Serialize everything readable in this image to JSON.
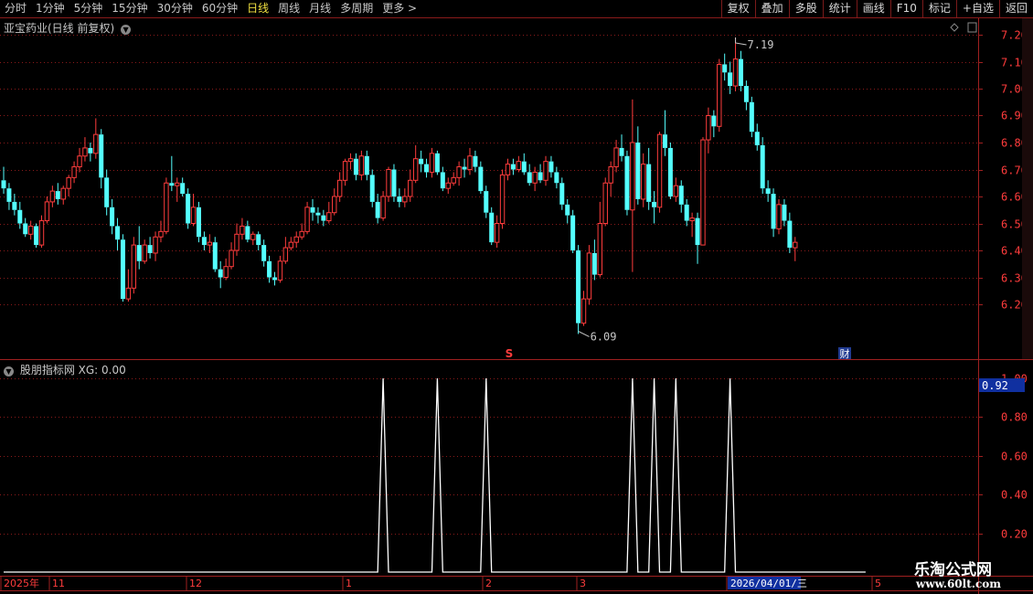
{
  "toolbar": {
    "periods": [
      "分时",
      "1分钟",
      "5分钟",
      "15分钟",
      "30分钟",
      "60分钟",
      "日线",
      "周线",
      "月线",
      "多周期",
      "更多 >"
    ],
    "active": "日线",
    "right": [
      "复权",
      "叠加",
      "多股",
      "统计",
      "画线",
      "F10",
      "标记",
      "+自选",
      "返回"
    ]
  },
  "main": {
    "title": "亚宝药业(日线 前复权)",
    "y_ticks": [
      "7.20",
      "7.10",
      "7.00",
      "6.90",
      "6.80",
      "6.70",
      "6.60",
      "6.50",
      "6.40",
      "6.30",
      "6.20"
    ],
    "high_label": "7.19",
    "low_label": "6.09",
    "marker_s": "S",
    "marker_cai": "财"
  },
  "indicator": {
    "title": "股朋指标网 XG: 0.00",
    "y_ticks": [
      "1.00",
      "0.80",
      "0.60",
      "0.40",
      "0.20"
    ],
    "cursor_value": "0.92"
  },
  "timeline": {
    "labels": [
      "2025年",
      "11",
      "12",
      "1",
      "2",
      "3",
      "2026/04/01/三",
      "5"
    ]
  },
  "watermark": {
    "line1": "乐淘公式网",
    "line2": "www.60lt.com"
  },
  "chart_data": [
    {
      "type": "candlestick",
      "title": "亚宝药业(日线 前复权)",
      "ylim": [
        6.09,
        7.22
      ],
      "y_ticks": [
        6.2,
        6.3,
        6.4,
        6.5,
        6.6,
        6.7,
        6.8,
        6.9,
        7.0,
        7.1,
        7.2
      ],
      "grid": true,
      "candles": [
        [
          6.66,
          6.63,
          6.71,
          6.61
        ],
        [
          6.63,
          6.58,
          6.65,
          6.55
        ],
        [
          6.58,
          6.55,
          6.61,
          6.53
        ],
        [
          6.55,
          6.5,
          6.58,
          6.48
        ],
        [
          6.5,
          6.46,
          6.52,
          6.45
        ],
        [
          6.46,
          6.49,
          6.51,
          6.44
        ],
        [
          6.49,
          6.42,
          6.5,
          6.41
        ],
        [
          6.42,
          6.51,
          6.53,
          6.41
        ],
        [
          6.51,
          6.58,
          6.6,
          6.5
        ],
        [
          6.58,
          6.62,
          6.64,
          6.56
        ],
        [
          6.62,
          6.59,
          6.65,
          6.57
        ],
        [
          6.59,
          6.63,
          6.64,
          6.57
        ],
        [
          6.63,
          6.67,
          6.68,
          6.6
        ],
        [
          6.67,
          6.71,
          6.73,
          6.65
        ],
        [
          6.71,
          6.75,
          6.78,
          6.69
        ],
        [
          6.75,
          6.78,
          6.82,
          6.73
        ],
        [
          6.78,
          6.76,
          6.8,
          6.73
        ],
        [
          6.76,
          6.83,
          6.89,
          6.74
        ],
        [
          6.83,
          6.67,
          6.85,
          6.63
        ],
        [
          6.67,
          6.56,
          6.7,
          6.53
        ],
        [
          6.56,
          6.49,
          6.59,
          6.46
        ],
        [
          6.49,
          6.44,
          6.52,
          6.4
        ],
        [
          6.44,
          6.22,
          6.46,
          6.21
        ],
        [
          6.22,
          6.26,
          6.33,
          6.21
        ],
        [
          6.26,
          6.42,
          6.45,
          6.24
        ],
        [
          6.42,
          6.36,
          6.49,
          6.33
        ],
        [
          6.36,
          6.42,
          6.44,
          6.35
        ],
        [
          6.42,
          6.39,
          6.45,
          6.37
        ],
        [
          6.39,
          6.45,
          6.47,
          6.36
        ],
        [
          6.45,
          6.47,
          6.51,
          6.43
        ],
        [
          6.47,
          6.65,
          6.67,
          6.46
        ],
        [
          6.65,
          6.64,
          6.75,
          6.62
        ],
        [
          6.64,
          6.65,
          6.67,
          6.58
        ],
        [
          6.65,
          6.61,
          6.67,
          6.6
        ],
        [
          6.61,
          6.5,
          6.63,
          6.48
        ],
        [
          6.5,
          6.56,
          6.61,
          6.49
        ],
        [
          6.56,
          6.45,
          6.58,
          6.43
        ],
        [
          6.45,
          6.42,
          6.47,
          6.4
        ],
        [
          6.42,
          6.43,
          6.46,
          6.39
        ],
        [
          6.43,
          6.33,
          6.45,
          6.32
        ],
        [
          6.33,
          6.3,
          6.36,
          6.26
        ],
        [
          6.3,
          6.34,
          6.37,
          6.29
        ],
        [
          6.34,
          6.4,
          6.43,
          6.33
        ],
        [
          6.4,
          6.46,
          6.5,
          6.38
        ],
        [
          6.46,
          6.49,
          6.52,
          6.44
        ],
        [
          6.49,
          6.44,
          6.51,
          6.43
        ],
        [
          6.44,
          6.46,
          6.47,
          6.42
        ],
        [
          6.46,
          6.42,
          6.47,
          6.4
        ],
        [
          6.42,
          6.36,
          6.44,
          6.34
        ],
        [
          6.36,
          6.3,
          6.38,
          6.28
        ],
        [
          6.3,
          6.29,
          6.32,
          6.27
        ],
        [
          6.29,
          6.36,
          6.38,
          6.28
        ],
        [
          6.36,
          6.41,
          6.45,
          6.35
        ],
        [
          6.41,
          6.43,
          6.45,
          6.4
        ],
        [
          6.43,
          6.45,
          6.47,
          6.41
        ],
        [
          6.45,
          6.47,
          6.5,
          6.44
        ],
        [
          6.47,
          6.56,
          6.58,
          6.46
        ],
        [
          6.56,
          6.54,
          6.59,
          6.51
        ],
        [
          6.54,
          6.53,
          6.56,
          6.5
        ],
        [
          6.53,
          6.51,
          6.55,
          6.49
        ],
        [
          6.51,
          6.54,
          6.58,
          6.5
        ],
        [
          6.54,
          6.6,
          6.63,
          6.53
        ],
        [
          6.6,
          6.66,
          6.69,
          6.58
        ],
        [
          6.66,
          6.73,
          6.74,
          6.64
        ],
        [
          6.73,
          6.74,
          6.76,
          6.7
        ],
        [
          6.74,
          6.68,
          6.76,
          6.66
        ],
        [
          6.68,
          6.75,
          6.77,
          6.66
        ],
        [
          6.75,
          6.68,
          6.77,
          6.66
        ],
        [
          6.68,
          6.58,
          6.7,
          6.56
        ],
        [
          6.58,
          6.52,
          6.61,
          6.5
        ],
        [
          6.52,
          6.6,
          6.62,
          6.51
        ],
        [
          6.6,
          6.7,
          6.71,
          6.58
        ],
        [
          6.7,
          6.6,
          6.72,
          6.58
        ],
        [
          6.6,
          6.58,
          6.63,
          6.56
        ],
        [
          6.58,
          6.6,
          6.63,
          6.56
        ],
        [
          6.6,
          6.66,
          6.7,
          6.58
        ],
        [
          6.66,
          6.74,
          6.79,
          6.65
        ],
        [
          6.74,
          6.72,
          6.77,
          6.69
        ],
        [
          6.72,
          6.69,
          6.74,
          6.67
        ],
        [
          6.69,
          6.76,
          6.78,
          6.67
        ],
        [
          6.76,
          6.69,
          6.77,
          6.68
        ],
        [
          6.69,
          6.63,
          6.71,
          6.62
        ],
        [
          6.63,
          6.65,
          6.67,
          6.61
        ],
        [
          6.65,
          6.67,
          6.69,
          6.64
        ],
        [
          6.67,
          6.71,
          6.73,
          6.64
        ],
        [
          6.71,
          6.7,
          6.74,
          6.67
        ],
        [
          6.7,
          6.75,
          6.78,
          6.68
        ],
        [
          6.75,
          6.71,
          6.77,
          6.69
        ],
        [
          6.71,
          6.62,
          6.73,
          6.61
        ],
        [
          6.62,
          6.54,
          6.64,
          6.52
        ],
        [
          6.54,
          6.43,
          6.56,
          6.42
        ],
        [
          6.43,
          6.5,
          6.53,
          6.41
        ],
        [
          6.5,
          6.68,
          6.7,
          6.48
        ],
        [
          6.68,
          6.72,
          6.74,
          6.66
        ],
        [
          6.72,
          6.7,
          6.74,
          6.68
        ],
        [
          6.7,
          6.73,
          6.75,
          6.69
        ],
        [
          6.73,
          6.69,
          6.76,
          6.68
        ],
        [
          6.69,
          6.65,
          6.72,
          6.64
        ],
        [
          6.65,
          6.69,
          6.71,
          6.62
        ],
        [
          6.69,
          6.66,
          6.72,
          6.65
        ],
        [
          6.66,
          6.73,
          6.75,
          6.64
        ],
        [
          6.73,
          6.69,
          6.75,
          6.67
        ],
        [
          6.69,
          6.65,
          6.71,
          6.63
        ],
        [
          6.65,
          6.57,
          6.67,
          6.55
        ],
        [
          6.57,
          6.53,
          6.59,
          6.5
        ],
        [
          6.53,
          6.4,
          6.55,
          6.39
        ],
        [
          6.4,
          6.13,
          6.42,
          6.09
        ],
        [
          6.13,
          6.22,
          6.25,
          6.12
        ],
        [
          6.22,
          6.39,
          6.42,
          6.2
        ],
        [
          6.39,
          6.31,
          6.44,
          6.29
        ],
        [
          6.31,
          6.5,
          6.58,
          6.3
        ],
        [
          6.5,
          6.65,
          6.67,
          6.49
        ],
        [
          6.65,
          6.71,
          6.73,
          6.6
        ],
        [
          6.71,
          6.78,
          6.81,
          6.69
        ],
        [
          6.78,
          6.75,
          6.83,
          6.73
        ],
        [
          6.75,
          6.55,
          6.77,
          6.53
        ],
        [
          6.55,
          6.8,
          6.96,
          6.32
        ],
        [
          6.8,
          6.59,
          6.86,
          6.57
        ],
        [
          6.59,
          6.72,
          6.76,
          6.56
        ],
        [
          6.72,
          6.58,
          6.78,
          6.55
        ],
        [
          6.58,
          6.56,
          6.62,
          6.5
        ],
        [
          6.56,
          6.83,
          6.84,
          6.54
        ],
        [
          6.83,
          6.78,
          6.92,
          6.75
        ],
        [
          6.78,
          6.6,
          6.8,
          6.59
        ],
        [
          6.6,
          6.64,
          6.67,
          6.58
        ],
        [
          6.64,
          6.57,
          6.66,
          6.54
        ],
        [
          6.57,
          6.51,
          6.59,
          6.49
        ],
        [
          6.51,
          6.52,
          6.54,
          6.45
        ],
        [
          6.52,
          6.42,
          6.54,
          6.35
        ],
        [
          6.42,
          6.81,
          6.82,
          6.42
        ],
        [
          6.81,
          6.9,
          6.93,
          6.76
        ],
        [
          6.9,
          6.86,
          6.92,
          6.82
        ],
        [
          6.86,
          7.09,
          7.11,
          6.84
        ],
        [
          7.09,
          7.06,
          7.13,
          7.03
        ],
        [
          7.06,
          7.01,
          7.1,
          6.98
        ],
        [
          7.01,
          7.11,
          7.19,
          6.99
        ],
        [
          7.11,
          7.01,
          7.14,
          6.99
        ],
        [
          7.01,
          6.95,
          7.03,
          6.92
        ],
        [
          6.95,
          6.84,
          6.97,
          6.82
        ],
        [
          6.84,
          6.79,
          6.87,
          6.77
        ],
        [
          6.79,
          6.63,
          6.82,
          6.61
        ],
        [
          6.63,
          6.61,
          6.66,
          6.58
        ],
        [
          6.61,
          6.48,
          6.63,
          6.45
        ],
        [
          6.48,
          6.57,
          6.59,
          6.46
        ],
        [
          6.57,
          6.51,
          6.59,
          6.49
        ],
        [
          6.51,
          6.41,
          6.54,
          6.39
        ],
        [
          6.41,
          6.43,
          6.45,
          6.36
        ]
      ]
    },
    {
      "type": "line",
      "title": "股朋指标网 XG",
      "ylim": [
        0,
        1
      ],
      "y_ticks": [
        0.2,
        0.4,
        0.6,
        0.8,
        1.0
      ],
      "series": [
        {
          "values": [
            0,
            0,
            0,
            0,
            0,
            0,
            0,
            0,
            0,
            0,
            0,
            0,
            0,
            0,
            0,
            0,
            0,
            0,
            0,
            0,
            0,
            0,
            0,
            0,
            0,
            0,
            0,
            0,
            0,
            0,
            0,
            0,
            0,
            0,
            0,
            0,
            0,
            0,
            0,
            0,
            0,
            0,
            0,
            0,
            0,
            0,
            0,
            0,
            0,
            0,
            0,
            0,
            0,
            0,
            0,
            0,
            0,
            0,
            0,
            0,
            0,
            0,
            0,
            0,
            0,
            0,
            0,
            0,
            0,
            0,
            0,
            0,
            0,
            0,
            0,
            0,
            0,
            0,
            0,
            0,
            0,
            0,
            0,
            0,
            0,
            0,
            0,
            0,
            0,
            0,
            0,
            0,
            0,
            0,
            0,
            0,
            0,
            0,
            0,
            0,
            0,
            0,
            0,
            0,
            0,
            0,
            0,
            0,
            0,
            0,
            0,
            0,
            0,
            0,
            0,
            0,
            0,
            0,
            0,
            0,
            0,
            0,
            0,
            0,
            0,
            0,
            0,
            0,
            0,
            0,
            0,
            0,
            0,
            0,
            0,
            0,
            0,
            0,
            0,
            0,
            0,
            0,
            0,
            0,
            0,
            0,
            0,
            0,
            0,
            0,
            0,
            0,
            0,
            0,
            0,
            0,
            0,
            0,
            0,
            0
          ]
        }
      ],
      "spikes": [
        {
          "index": 70,
          "value": 1
        },
        {
          "index": 80,
          "value": 1
        },
        {
          "index": 89,
          "value": 1
        },
        {
          "index": 116,
          "value": 1
        },
        {
          "index": 120,
          "value": 1
        },
        {
          "index": 124,
          "value": 1
        },
        {
          "index": 134,
          "value": 1
        }
      ]
    }
  ]
}
